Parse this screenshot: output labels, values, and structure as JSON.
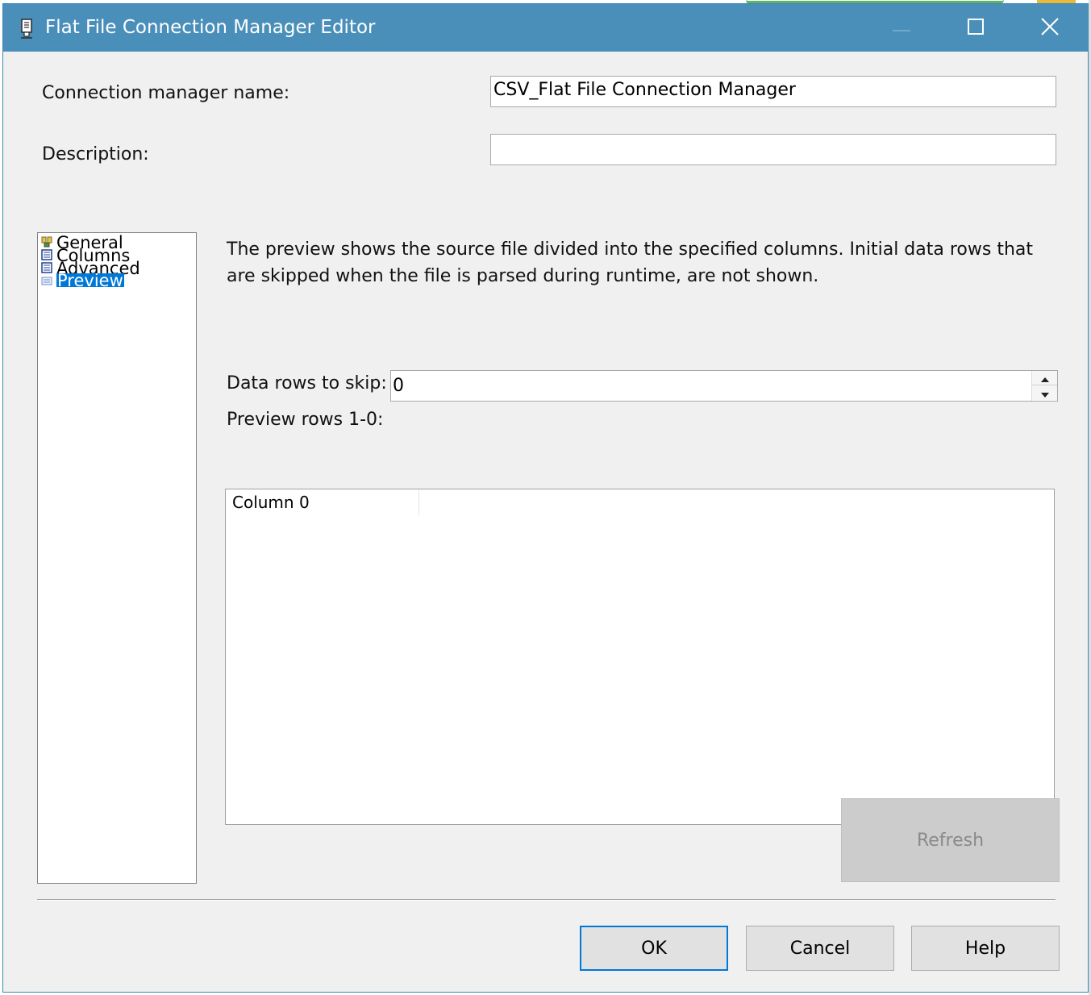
{
  "window": {
    "title": "Flat File Connection Manager Editor",
    "icon": "flat-file-icon",
    "controls": [
      "minimize-icon",
      "maximize-icon",
      "close-icon"
    ]
  },
  "form": {
    "name_label": "Connection manager name:",
    "name_value": "CSV_Flat File Connection Manager",
    "description_label": "Description:",
    "description_value": ""
  },
  "nav": {
    "items": [
      {
        "label": "General",
        "icon": "general-icon"
      },
      {
        "label": "Columns",
        "icon": "columns-icon"
      },
      {
        "label": "Advanced",
        "icon": "advanced-icon"
      },
      {
        "label": "Preview",
        "icon": "preview-icon",
        "selected": true
      }
    ]
  },
  "preview": {
    "description": "The preview shows the source file divided into the specified columns. Initial data rows that are skipped when the file is parsed during runtime, are not shown.",
    "skip_label": "Data rows to skip:",
    "skip_value": "0",
    "rows_label": "Preview rows 1-0:",
    "grid_columns": [
      "Column 0"
    ],
    "refresh_label": "Refresh"
  },
  "buttons": {
    "ok": "OK",
    "cancel": "Cancel",
    "help": "Help"
  },
  "colors": {
    "titlebar": "#4a8fb9",
    "selection": "#0078d7",
    "dialog_bg": "#f0f0f0"
  }
}
